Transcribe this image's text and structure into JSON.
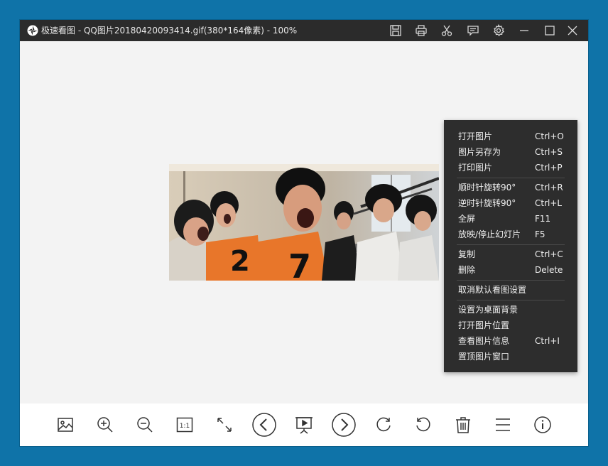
{
  "titlebar": {
    "app_name": "极速看图",
    "title": "QQ图片20180420093414.gif(380*164像素) - 100%",
    "separator": " - "
  },
  "icons": {
    "titlebar": [
      "save-icon",
      "print-icon",
      "scissors-icon",
      "feedback-icon",
      "gear-icon",
      "minimize-icon",
      "maximize-icon",
      "close-icon"
    ],
    "toolbar": [
      "image-icon",
      "zoom-in-icon",
      "zoom-out-icon",
      "actual-size-icon",
      "fit-window-icon",
      "previous-icon",
      "slideshow-icon",
      "next-icon",
      "rotate-clockwise-icon",
      "rotate-counterclockwise-icon",
      "trash-icon",
      "menu-icon",
      "info-icon"
    ]
  },
  "toolbar": {
    "actual_size_label": "1:1"
  },
  "context_menu": {
    "items": [
      {
        "label": "打开图片",
        "shortcut": "Ctrl+O"
      },
      {
        "label": "图片另存为",
        "shortcut": "Ctrl+S"
      },
      {
        "label": "打印图片",
        "shortcut": "Ctrl+P"
      },
      {
        "label": "顺时针旋转90°",
        "shortcut": "Ctrl+R"
      },
      {
        "label": "逆时针旋转90°",
        "shortcut": "Ctrl+L"
      },
      {
        "label": "全屏",
        "shortcut": "F11"
      },
      {
        "label": "放映/停止幻灯片",
        "shortcut": "F5"
      },
      {
        "label": "复制",
        "shortcut": "Ctrl+C"
      },
      {
        "label": "删除",
        "shortcut": "Delete"
      },
      {
        "label": "取消默认看图设置",
        "shortcut": ""
      },
      {
        "label": "设置为桌面背景",
        "shortcut": ""
      },
      {
        "label": "打开图片位置",
        "shortcut": ""
      },
      {
        "label": "查看图片信息",
        "shortcut": "Ctrl+I"
      },
      {
        "label": "置顶图片窗口",
        "shortcut": ""
      }
    ]
  },
  "colors": {
    "desktop": "#0f73a8",
    "titlebar": "#2b2b2b",
    "canvas": "#f3f3f3",
    "menu_bg": "#2d2d2d",
    "vest": "#e8762a"
  },
  "photo": {
    "jersey_numbers": [
      "2",
      "7"
    ]
  }
}
